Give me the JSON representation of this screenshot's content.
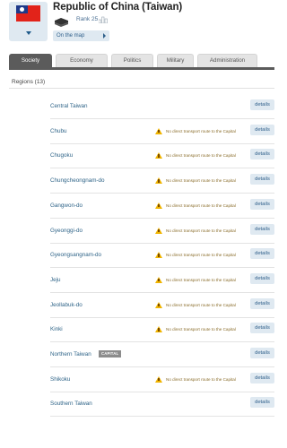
{
  "header": {
    "title": "Republic of China (Taiwan)",
    "rank": "Rank 25",
    "on_the_map": "On the map"
  },
  "flag": {
    "red": "#e2231a",
    "blue": "#1e3a8a",
    "white": "#ffffff"
  },
  "tabs": [
    {
      "label": "Society",
      "active": true
    },
    {
      "label": "Economy",
      "active": false
    },
    {
      "label": "Politics",
      "active": false
    },
    {
      "label": "Military",
      "active": false
    },
    {
      "label": "Administration",
      "active": false
    }
  ],
  "regions": {
    "header": "Regions (13)",
    "details_label": "details",
    "warning_text": "No direct transport route to the Capital",
    "capital_badge": "CAPITAL",
    "items": [
      {
        "name": "Central Taiwan",
        "warning": false,
        "capital": false
      },
      {
        "name": "Chubu",
        "warning": true,
        "capital": false
      },
      {
        "name": "Chugoku",
        "warning": true,
        "capital": false
      },
      {
        "name": "Chungcheongnam-do",
        "warning": true,
        "capital": false
      },
      {
        "name": "Gangwon-do",
        "warning": true,
        "capital": false
      },
      {
        "name": "Gyeonggi-do",
        "warning": true,
        "capital": false
      },
      {
        "name": "Gyeongsangnam-do",
        "warning": true,
        "capital": false
      },
      {
        "name": "Jeju",
        "warning": true,
        "capital": false
      },
      {
        "name": "Jeollabuk-do",
        "warning": true,
        "capital": false
      },
      {
        "name": "Kinki",
        "warning": true,
        "capital": false
      },
      {
        "name": "Northern Taiwan",
        "warning": false,
        "capital": true
      },
      {
        "name": "Shikoku",
        "warning": true,
        "capital": false
      },
      {
        "name": "Southern Taiwan",
        "warning": false,
        "capital": false
      }
    ]
  },
  "colors": {
    "link": "#2f6488",
    "button_bg": "#dfe9f1",
    "tab_active": "#5b5b5b",
    "warning": "#f0b400"
  }
}
